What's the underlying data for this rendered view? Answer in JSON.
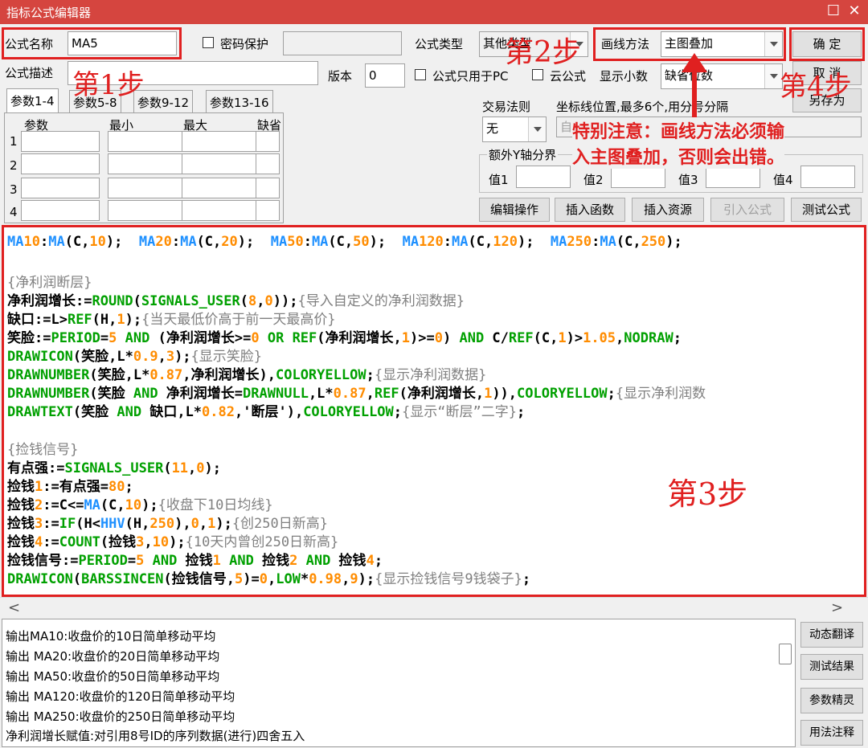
{
  "window": {
    "title": "指标公式编辑器",
    "max_glyph": "☐",
    "close_glyph": "✕"
  },
  "form": {
    "name_label": "公式名称",
    "name_value": "MA5",
    "password_label": "密码保护",
    "type_label": "公式类型",
    "type_value": "其他类型",
    "draw_label": "画线方法",
    "draw_value": "主图叠加",
    "ok_label": "确  定",
    "cancel_label": "取  消",
    "saveas_label": "另存为",
    "desc_label": "公式描述",
    "version_label": "版本",
    "version_value": "0",
    "pc_only_label": "公式只用于PC",
    "cloud_label": "云公式",
    "decimals_label": "显示小数",
    "decimals_value": "缺省位数",
    "trade_rule_label": "交易法则",
    "trade_rule_value": "无",
    "coord_label": "坐标线位置,最多6个,用分号分隔",
    "coord_value": "自",
    "yaxis_label": "额外Y轴分界",
    "val1_label": "值1",
    "val2_label": "值2",
    "val3_label": "值3",
    "val4_label": "值4"
  },
  "tabs": [
    "参数1-4",
    "参数5-8",
    "参数9-12",
    "参数13-16"
  ],
  "param_grid": {
    "headers": [
      "参数",
      "最小",
      "最大",
      "缺省"
    ],
    "rows": [
      "1",
      "2",
      "3",
      "4"
    ]
  },
  "action_buttons": [
    "编辑操作",
    "插入函数",
    "插入资源",
    "引入公式",
    "测试公式"
  ],
  "code_lines": [
    "MA10:MA(C,10);  MA20:MA(C,20);  MA50:MA(C,50);  MA120:MA(C,120);  MA250:MA(C,250);",
    "",
    "{净利润断层}",
    "净利润增长:=ROUND(SIGNALS_USER(8,0));{导入自定义的净利润数据}",
    "缺口:=L>REF(H,1);{当天最低价高于前一天最高价}",
    "笑脸:=PERIOD=5 AND (净利润增长>=0 OR REF(净利润增长,1)>=0) AND C/REF(C,1)>1.05,NODRAW;",
    "DRAWICON(笑脸,L*0.9,3);{显示笑脸}",
    "DRAWNUMBER(笑脸,L*0.87,净利润增长),COLORYELLOW;{显示净利润数据}",
    "DRAWNUMBER(笑脸 AND 净利润增长=DRAWNULL,L*0.87,REF(净利润增长,1)),COLORYELLOW;{显示净利润数",
    "DRAWTEXT(笑脸 AND 缺口,L*0.82,'断层'),COLORYELLOW;{显示“断层”二字};",
    "",
    "{捡钱信号}",
    "有点强:=SIGNALS_USER(11,0);",
    "捡钱1:=有点强=80;",
    "捡钱2:=C<=MA(C,10);{收盘下10日均线}",
    "捡钱3:=IF(H<HHV(H,250),0,1);{创250日新高}",
    "捡钱4:=COUNT(捡钱3,10);{10天内曾创250日新高}",
    "捡钱信号:=PERIOD=5 AND 捡钱1 AND 捡钱2 AND 捡钱4;",
    "DRAWICON(BARSSINCEN(捡钱信号,5)=0,LOW*0.98,9);{显示捡钱信号9钱袋子};"
  ],
  "output_lines": [
    "输出MA10:收盘价的10日简单移动平均",
    "输出  MA20:收盘价的20日简单移动平均",
    "输出  MA50:收盘价的50日简单移动平均",
    "输出  MA120:收盘价的120日简单移动平均",
    "输出  MA250:收盘价的250日简单移动平均",
    "净利润增长赋值:对引用8号ID的序列数据(进行)四舍五入"
  ],
  "side_buttons": [
    "动态翻译",
    "测试结果",
    "参数精灵",
    "用法注释"
  ],
  "scroll": {
    "left_glyph": "<",
    "right_glyph": ">"
  },
  "annotations": {
    "step1": "第1步",
    "step2": "第2步",
    "step3": "第3步",
    "step4": "第4步",
    "note_line1": "特别注意：画线方法必须输",
    "note_line2": "入主图叠加，否则会出错。"
  },
  "colors": {
    "title_bar": "#d5453f",
    "annotation_red": "#e02020",
    "keyword": "#00a000",
    "function": "#1e90ff",
    "number": "#ff8c00",
    "comment": "#808080"
  }
}
